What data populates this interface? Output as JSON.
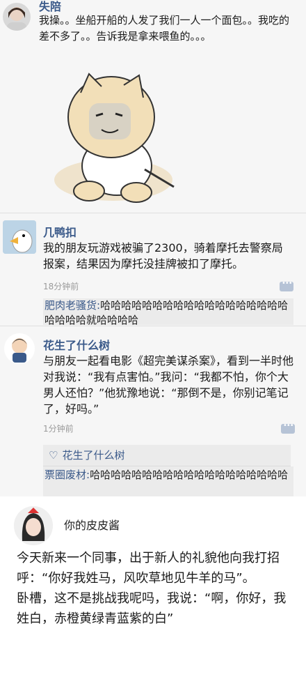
{
  "post1": {
    "name": "失陪",
    "text": "我操。。坐船开船的人发了我们一人一个面包。。我吃的差不多了。。告诉我是拿来喂鱼的。。。"
  },
  "post2": {
    "name": "几鸭扣",
    "text": "我的朋友玩游戏被骗了2300，骑着摩托去警察局报案，结果因为摩托没挂牌被扣了摩托。",
    "time": "18分钟前",
    "comment_user": "肥肉老骚货:",
    "comment_text": "哈哈哈哈哈哈哈哈哈哈哈哈哈哈哈哈哈哈哈哈哈哈就哈哈哈哈"
  },
  "post3": {
    "name": "花生了什么树",
    "text": "与朋友一起看电影《超完美谋杀案》，看到一半时他对我说：“我有点害怕。”我问：“我都不怕，你个大男人还怕？”他犹豫地说：“那倒不是，你别记笔记了，好吗。”",
    "time": "1分钟前",
    "like_icon": "heart-icon",
    "like_user": "花生了什么树",
    "comment_user": "票圈废材:",
    "comment_text": "哈哈哈哈哈哈哈哈哈哈哈哈哈哈哈哈哈哈哈"
  },
  "post4": {
    "name": "你的皮皮酱",
    "text": "今天新来一个同事，出于新人的礼貌他向我打招呼：“你好我姓马，风吹草地见牛羊的马”。\n卧槽，这不是挑战我呢吗，我说：“啊，你好，我姓白，赤橙黄绿青蓝紫的白”"
  }
}
